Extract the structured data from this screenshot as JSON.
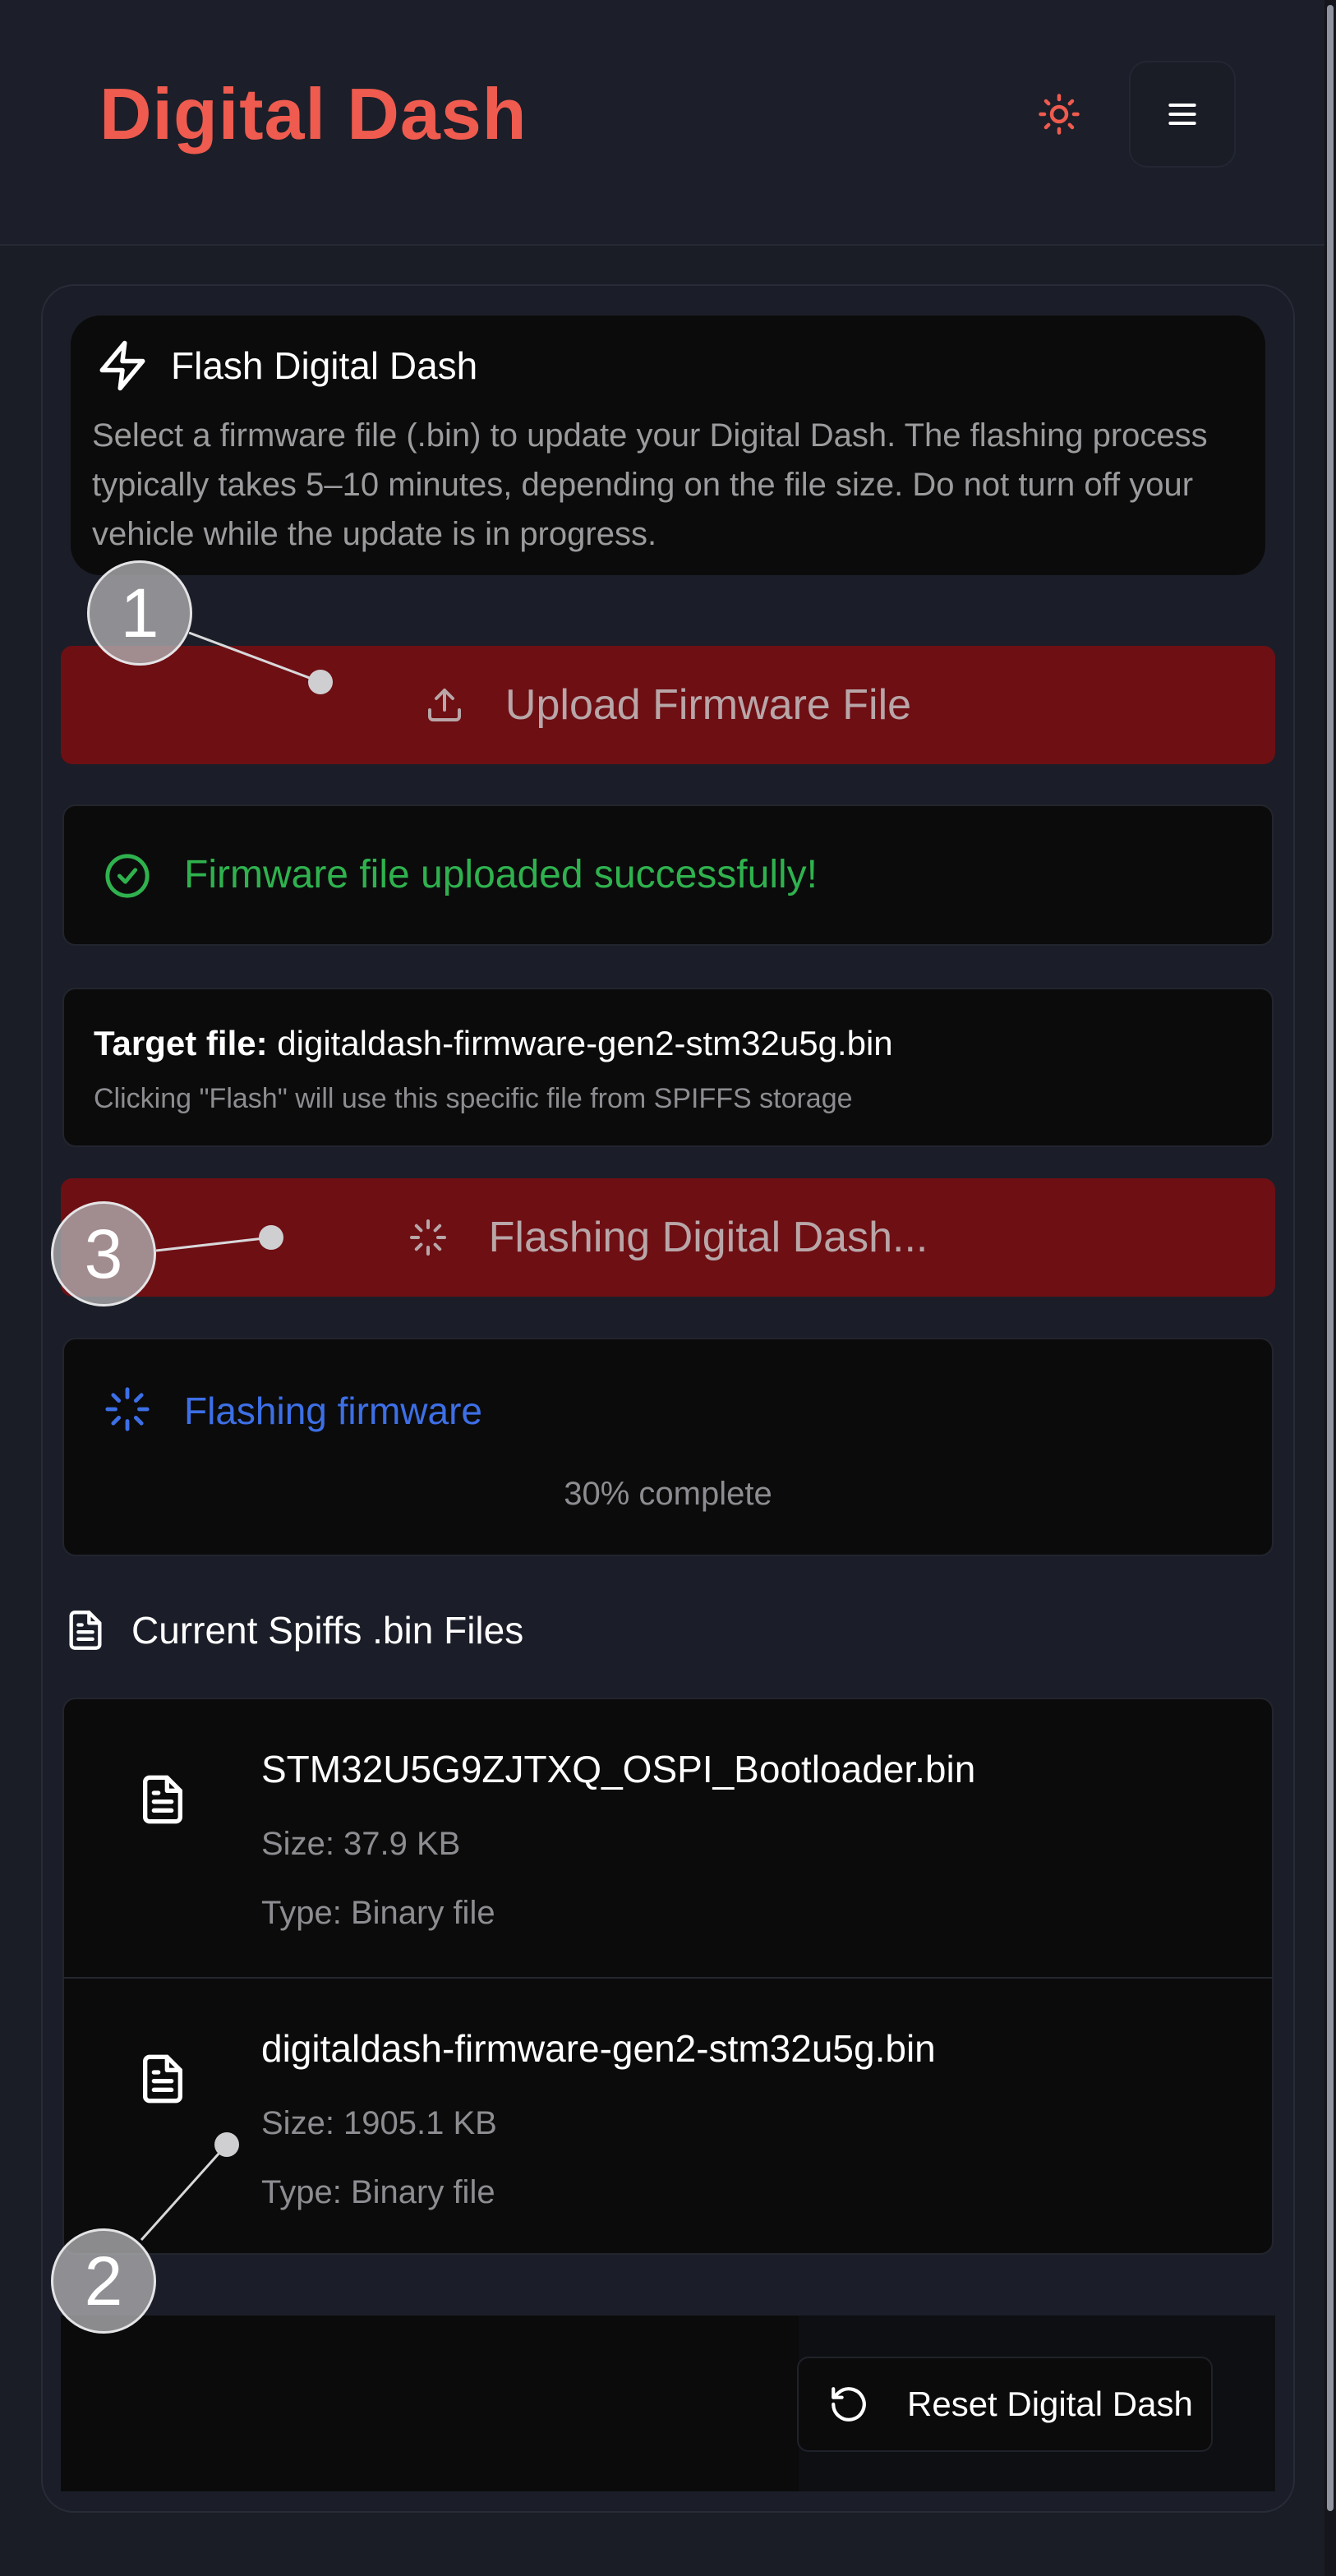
{
  "app": {
    "title": "Digital Dash"
  },
  "header": {
    "theme_icon": "sun-icon",
    "menu_icon": "hamburger-menu-icon",
    "accent": "#ef5b4f"
  },
  "intro": {
    "title": "Flash Digital Dash",
    "description": "Select a firmware file (.bin) to update your Digital Dash. The flashing process typically takes 5–10 minutes, depending on the file size. Do not turn off your vehicle while the update is in progress."
  },
  "upload": {
    "label": "Upload Firmware File",
    "icon": "upload-icon"
  },
  "success": {
    "message": "Firmware file uploaded successfully!",
    "color": "#2fb24e"
  },
  "target": {
    "label": "Target file:",
    "filename": "digitaldash-firmware-gen2-stm32u5g.bin",
    "note": "Clicking \"Flash\" will use this specific file from SPIFFS storage"
  },
  "flash_button": {
    "label": "Flashing Digital Dash..."
  },
  "progress": {
    "label": "Flashing firmware",
    "percent_text": "30% complete",
    "percent": 30,
    "color": "#3d6fe6"
  },
  "files_section": {
    "title": "Current Spiffs .bin Files"
  },
  "files": [
    {
      "name": "STM32U5G9ZJTXQ_OSPI_Bootloader.bin",
      "size": "Size: 37.9 KB",
      "type": "Type: Binary file"
    },
    {
      "name": "digitaldash-firmware-gen2-stm32u5g.bin",
      "size": "Size: 1905.1 KB",
      "type": "Type: Binary file"
    }
  ],
  "reset": {
    "label": "Reset Digital Dash",
    "icon": "rotate-ccw-icon"
  },
  "markers": [
    "1",
    "2",
    "3"
  ]
}
